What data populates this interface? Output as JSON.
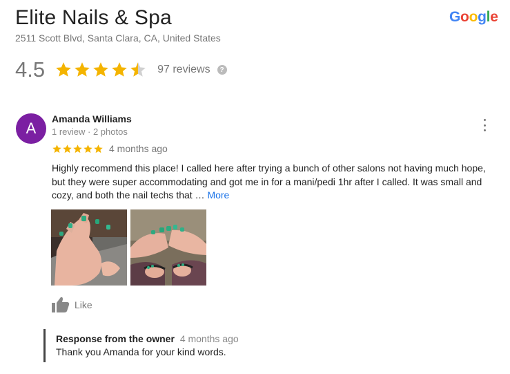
{
  "business": {
    "name": "Elite Nails & Spa",
    "address": "2511 Scott Blvd, Santa Clara, CA, United States",
    "rating": "4.5",
    "rating_value": 4.5,
    "reviews_label": "97 reviews",
    "help_glyph": "?"
  },
  "brand": {
    "logo_letters": [
      "G",
      "o",
      "o",
      "g",
      "l",
      "e"
    ],
    "logo_colors": [
      "#4285F4",
      "#EA4335",
      "#FBBC05",
      "#4285F4",
      "#34A853",
      "#EA4335"
    ],
    "star_color": "#F4B400"
  },
  "review": {
    "avatar_letter": "A",
    "avatar_color": "#7B1FA2",
    "author": "Amanda Williams",
    "meta": "1 review · 2 photos",
    "stars": 5,
    "time": "4 months ago",
    "text": "Highly recommend this place! I called here after trying a bunch of other salons not having much hope, but they were super accommodating and got me in for a mani/pedi 1hr after I called. It was small and cozy, and both the nail techs that … ",
    "more_label": "More",
    "like_label": "Like",
    "menu_icon": "more-vert-icon"
  },
  "owner_response": {
    "title": "Response from the owner",
    "time": "4 months ago",
    "text": "Thank you Amanda for your kind words."
  }
}
